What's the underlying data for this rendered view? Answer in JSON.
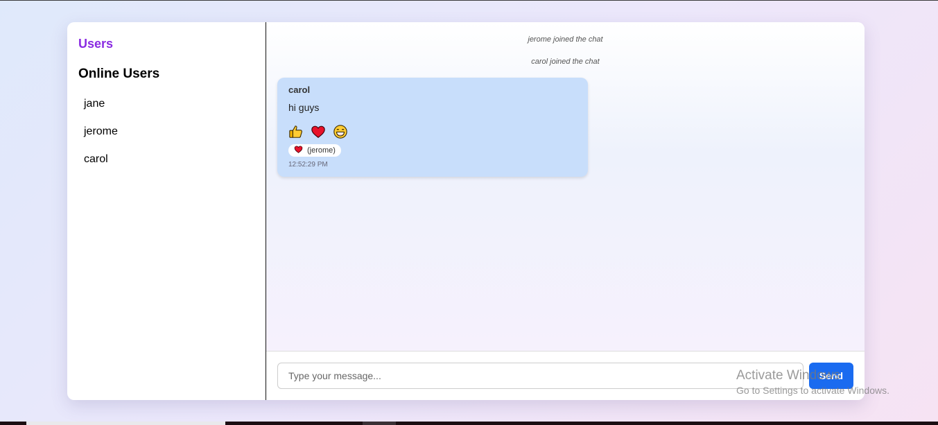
{
  "sidebar": {
    "title": "Users",
    "online_heading": "Online Users",
    "users": [
      "jane",
      "jerome",
      "carol"
    ]
  },
  "chat": {
    "system_messages": [
      "jerome joined the chat",
      "carol joined the chat"
    ],
    "messages": [
      {
        "sender": "carol",
        "text": "hi guys",
        "reaction_options": [
          "thumbs-up-icon",
          "heart-icon",
          "laughing-face-icon"
        ],
        "reactions": [
          {
            "icon": "heart-icon",
            "label": "(jerome)"
          }
        ],
        "time": "12:52:29 PM"
      }
    ]
  },
  "composer": {
    "placeholder": "Type your message...",
    "value": "",
    "send_label": "Send"
  },
  "watermark": {
    "title": "Activate Windows",
    "subtitle": "Go to Settings to activate Windows."
  },
  "colors": {
    "accent": "#8a2be2",
    "send_button": "#1a6bf0",
    "bubble": "#c8defb"
  }
}
